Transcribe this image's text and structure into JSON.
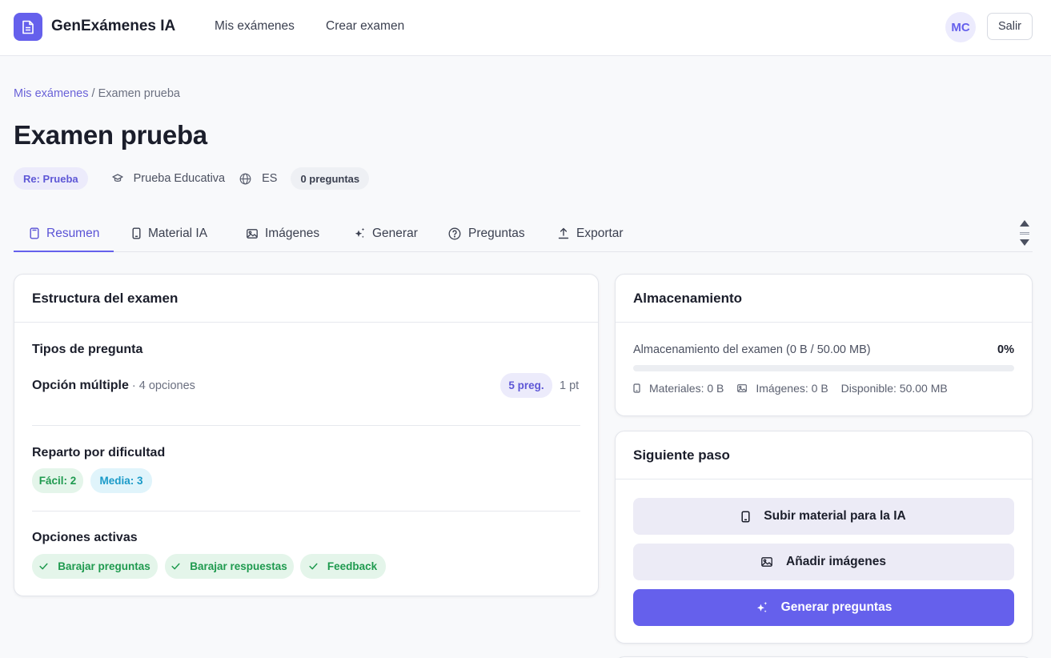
{
  "header": {
    "brand": "GenExámenes IA",
    "nav": [
      "Mis exámenes",
      "Crear examen"
    ],
    "avatar_initials": "MC",
    "logout_label": "Salir",
    "accent_color": "#6560ec"
  },
  "breadcrumb": {
    "parent": "Mis exámenes",
    "separator": " / ",
    "current": "Examen prueba"
  },
  "exam": {
    "title": "Examen prueba",
    "tag": "Re: Prueba",
    "category": "Prueba Educativa",
    "language": "ES",
    "question_count": "0 preguntas"
  },
  "tabs": [
    {
      "label": "Resumen",
      "icon": "file-icon"
    },
    {
      "label": "Material IA",
      "icon": "device-icon"
    },
    {
      "label": "Imágenes",
      "icon": "image-icon"
    },
    {
      "label": "Generar",
      "icon": "sparkles-icon"
    },
    {
      "label": "Preguntas",
      "icon": "question-circle-icon"
    },
    {
      "label": "Exportar",
      "icon": "upload-icon"
    }
  ],
  "structure": {
    "title": "Estructura del examen",
    "question_types_title": "Tipos de pregunta",
    "question_type": {
      "name": "Opción múltiple",
      "detail": " · 4 opciones",
      "count": "5 preg.",
      "points": "1 pt"
    },
    "difficulty_title": "Reparto por dificultad",
    "difficulty": [
      "Fácil: 2",
      "Media: 3"
    ],
    "options_title": "Opciones activas",
    "options": [
      "Barajar preguntas",
      "Barajar respuestas",
      "Feedback"
    ]
  },
  "storage": {
    "title": "Almacenamiento",
    "label": "Almacenamiento del examen (0 B / 50.00 MB)",
    "percent": "0%",
    "fill_fraction": 0,
    "materials": "Materiales: 0 B",
    "images": "Imágenes: 0 B",
    "available": "Disponible: 50.00 MB"
  },
  "next_step": {
    "title": "Siguiente paso",
    "upload_label": "Subir material para la IA",
    "add_images_label": "Añadir imágenes",
    "generate_label": "Generar preguntas"
  }
}
